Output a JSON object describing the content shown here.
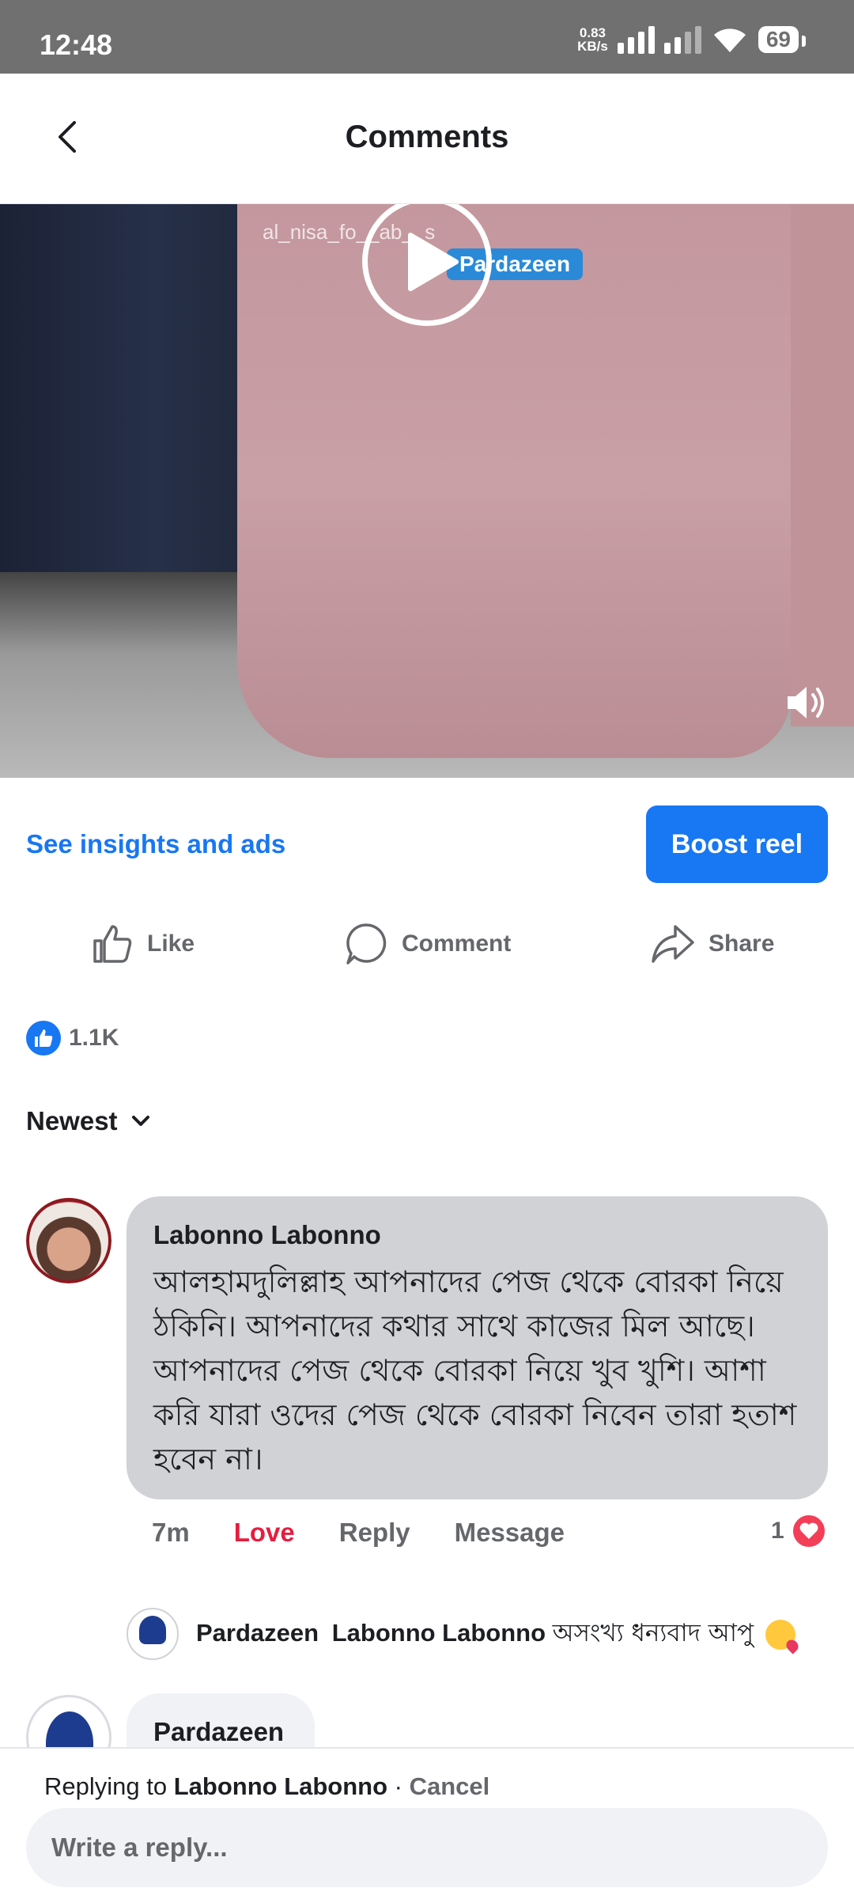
{
  "status_bar": {
    "time": "12:48",
    "net_speed_value": "0.83",
    "net_speed_unit": "KB/s",
    "battery": "69"
  },
  "header": {
    "title": "Comments"
  },
  "video": {
    "watermark_handle": "al_nisa_fo__ab__s",
    "watermark_brand": "Pardazeen"
  },
  "insights": {
    "link_label": "See insights and ads",
    "boost_label": "Boost reel"
  },
  "actions": {
    "like": "Like",
    "comment": "Comment",
    "share": "Share"
  },
  "reactions": {
    "count": "1.1K"
  },
  "sort": {
    "label": "Newest"
  },
  "comments": [
    {
      "author": "Labonno Labonno",
      "text": "আলহামদুলিল্লাহ আপনাদের পেজ থেকে বোরকা নিয়ে ঠকিনি। আপনাদের কথার সাথে কাজের মিল আছে। আপনাদের পেজ থেকে বোরকা নিয়ে খুব খুশি। আশা করি যারা ওদের পেজ থেকে বোরকা নিবেন তারা হতাশ হবেন না।",
      "time": "7m",
      "reaction_label": "Love",
      "reply_label": "Reply",
      "message_label": "Message",
      "reaction_count": "1",
      "replies": [
        {
          "author": "Pardazeen",
          "mention": "Labonno Labonno",
          "text": "অসংখ্য ধন্যবাদ আপু"
        }
      ]
    },
    {
      "author": "Pardazeen"
    }
  ],
  "composer": {
    "replying_prefix": "Replying to",
    "replying_name": "Labonno Labonno",
    "separator": " · ",
    "cancel_label": "Cancel",
    "placeholder": "Write a reply..."
  }
}
